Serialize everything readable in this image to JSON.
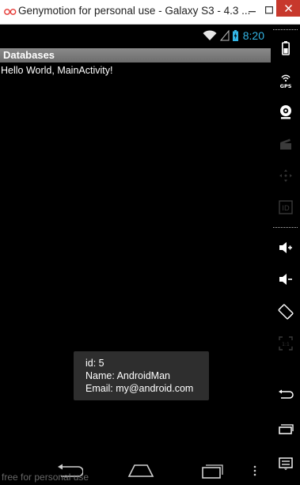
{
  "window": {
    "title": "Genymotion for personal use - Galaxy S3 - 4.3 ...",
    "minimize_label": "−",
    "maximize_label": "□",
    "close_label": "✕"
  },
  "statusbar": {
    "time": "8:20",
    "icons": [
      "wifi-icon",
      "signal-icon",
      "battery-charging-icon"
    ]
  },
  "actionbar": {
    "title": "Databases"
  },
  "main": {
    "hello_text": "Hello World, MainActivity!"
  },
  "toast": {
    "line1": "id: 5",
    "line2": "Name: AndroidMan",
    "line3": "Email:  my@android.com"
  },
  "navbar": {
    "buttons": [
      "back-icon",
      "home-icon",
      "recent-apps-icon",
      "menu-dots-icon"
    ]
  },
  "watermark": "free for personal use",
  "sidebar": {
    "items": [
      {
        "name": "battery-icon"
      },
      {
        "name": "gps-icon",
        "label": "GPS"
      },
      {
        "name": "webcam-icon"
      },
      {
        "name": "camera-clapper-icon"
      },
      {
        "name": "dpad-icon"
      },
      {
        "name": "device-id-icon",
        "label": "ID"
      },
      {
        "name": "volume-up-icon"
      },
      {
        "name": "volume-down-icon"
      },
      {
        "name": "rotate-icon"
      },
      {
        "name": "fullscreen-icon",
        "label": "1:1"
      },
      {
        "name": "back-icon"
      },
      {
        "name": "recent-apps-icon"
      },
      {
        "name": "menu-icon"
      }
    ]
  },
  "colors": {
    "accent_time": "#33b5e5",
    "close_button": "#c7382c",
    "actionbar": "#7a7a7a",
    "toast_bg": "#2e2e2e"
  }
}
